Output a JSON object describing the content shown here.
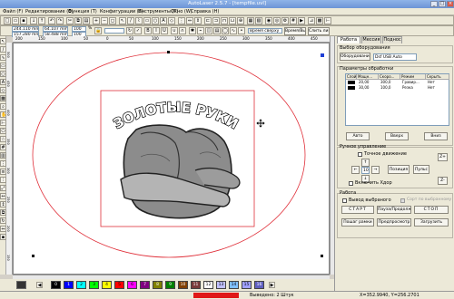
{
  "window": {
    "title": "AutoLaser 2.5.7 - [tempfile.uvl]"
  },
  "menu": [
    "Файл (F)",
    "Редактирование (E)",
    "Функция (T)",
    "Конфигурации (S)",
    "Инструменты (T)",
    "Окно (W)",
    "Справка (H)"
  ],
  "toolbar": {
    "pos_x": "244.110 mm",
    "pos_y": "157.280 mm",
    "size_w": "64.107 mm",
    "size_h": "58.488 mm",
    "scale_w": "100",
    "scale_h": "100",
    "percent": "%",
    "mode_label": "Время сверху",
    "time_label": "Время/Вывод",
    "merge_label": "Слить линии"
  },
  "ruler_top": [
    "200",
    "150",
    "100",
    "50",
    "0",
    "50",
    "100",
    "150",
    "200",
    "250",
    "300",
    "350",
    "400",
    "450"
  ],
  "ruler_left": [
    "500",
    "450",
    "400",
    "350",
    "300",
    "250",
    "200",
    "150"
  ],
  "canvas": {
    "artwork_text": "ЗОЛОТЫЕ РУКИ"
  },
  "palette": [
    "0",
    "1",
    "2",
    "3",
    "4",
    "5",
    "6",
    "7",
    "8",
    "9",
    "10",
    "11",
    "12",
    "13",
    "14",
    "15",
    "16"
  ],
  "palette_colors": [
    "#000000",
    "#0000ff",
    "#00ffff",
    "#00ff00",
    "#ffff00",
    "#ff0000",
    "#ff00ff",
    "#800080",
    "#808000",
    "#008000",
    "#804000",
    "#7a3b3b",
    "#ffffff",
    "#c0c0ff",
    "#80c0ff",
    "#a0a0ff",
    "#6060c0"
  ],
  "status": {
    "segment_a": "",
    "output": "Выведено: 2 Штук",
    "coords": "X=352.9940, Y=256.2701"
  },
  "panel": {
    "tabs": [
      "Работа",
      "Мессия",
      "Поднос"
    ],
    "device_group": "Выбор оборудования",
    "device_button": "Оборудование",
    "device_value": "Dsf USB Auto",
    "params_group": "Параметры обработки",
    "table_headers": [
      "Слой",
      "Мощн...",
      "Скоро...",
      "Режим",
      "Скрыть"
    ],
    "table_rows": [
      {
        "layer": "",
        "power": "20,00",
        "speed": "300,0",
        "mode": "Гравир...",
        "hide": "Нет"
      },
      {
        "layer": "",
        "power": "30,00",
        "speed": "100,0",
        "mode": "Резка",
        "hide": "Нет"
      }
    ],
    "btn_auto": "Авто",
    "btn_up": "Вверх",
    "btn_down": "Вниз",
    "manual_group": "Ручное управление",
    "precise_move": "Точное движение",
    "move_step": "10",
    "btn_position": "Позиция",
    "btn_pulse": "Пульс",
    "enable_blow": "Включить Хдор",
    "work_group": "Работа",
    "output_selected": "Вывод выбраного",
    "sort_output": "Сорт по выбранному",
    "btn_start": "СТАРТ",
    "btn_pause": "Пауза/Продолж",
    "btn_stop": "СТОП",
    "btn_frame": "Пошаг рамки",
    "btn_preview": "Предпросмотр",
    "btn_load": "Загрузить"
  }
}
